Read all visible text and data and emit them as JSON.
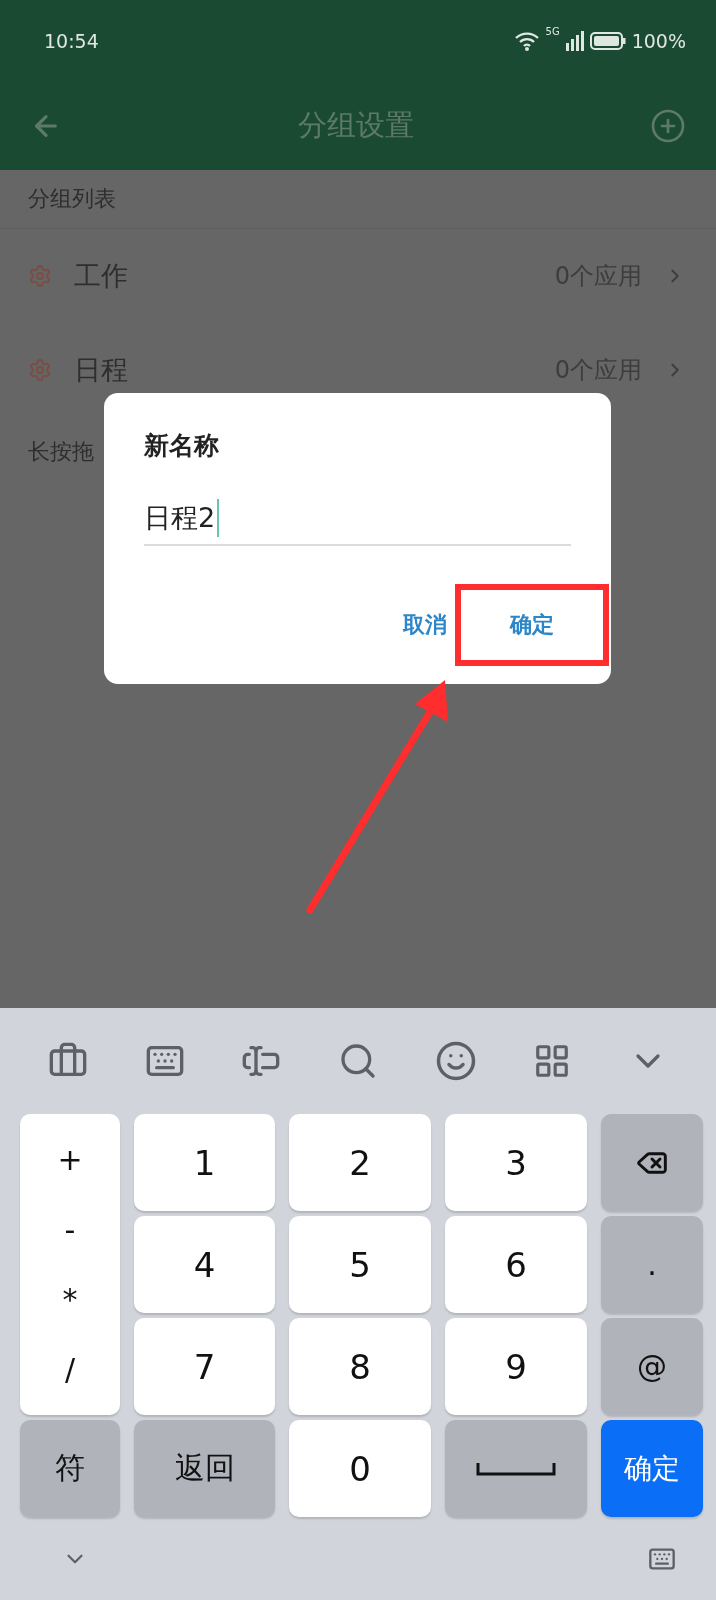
{
  "status_bar": {
    "time": "10:54",
    "network": "5G",
    "battery": "100%"
  },
  "app_bar": {
    "title": "分组设置"
  },
  "section_header": "分组列表",
  "groups": [
    {
      "name": "工作",
      "count": "0个应用"
    },
    {
      "name": "日程",
      "count": "0个应用"
    }
  ],
  "hint": "长按拖",
  "dialog": {
    "title": "新名称",
    "value": "日程2",
    "buttons": [
      {
        "label": "取消",
        "highlighted": false
      },
      {
        "label": "确定",
        "highlighted": true
      }
    ]
  },
  "keyboard": {
    "symbols": [
      "+",
      "-",
      "*",
      "/"
    ],
    "keys": [
      {
        "kind": "digit",
        "label": "1"
      },
      {
        "kind": "digit",
        "label": "2"
      },
      {
        "kind": "digit",
        "label": "3"
      },
      {
        "kind": "backspace"
      },
      {
        "kind": "digit",
        "label": "4"
      },
      {
        "kind": "digit",
        "label": "5"
      },
      {
        "kind": "digit",
        "label": "6"
      },
      {
        "kind": "func",
        "label": "."
      },
      {
        "kind": "digit",
        "label": "7"
      },
      {
        "kind": "digit",
        "label": "8"
      },
      {
        "kind": "digit",
        "label": "9"
      },
      {
        "kind": "func",
        "label": "@"
      },
      {
        "kind": "func",
        "label": "符"
      },
      {
        "kind": "func",
        "label": "返回"
      },
      {
        "kind": "digit",
        "label": "0"
      },
      {
        "kind": "space"
      },
      {
        "kind": "enter",
        "label": "确定"
      }
    ]
  }
}
